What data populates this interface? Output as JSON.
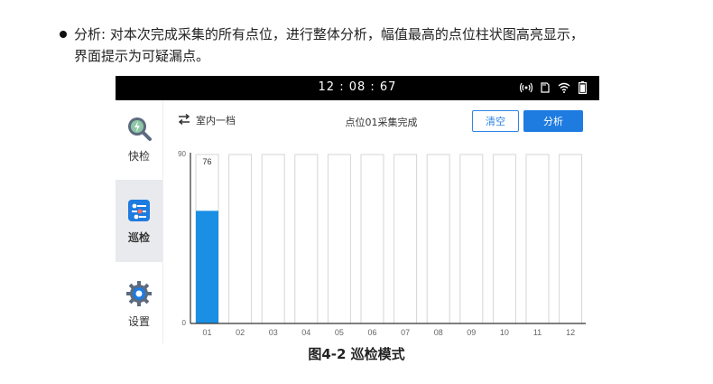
{
  "doc": {
    "bullet_line1": "分析: 对本次完成采集的所有点位，进行整体分析，幅值最高的点位柱状图高亮显示，",
    "bullet_line2": "界面提示为可疑漏点。",
    "caption": "图4-2  巡检模式"
  },
  "status_bar": {
    "time": "12 : 08 : 67"
  },
  "sidebar": {
    "items": [
      {
        "label": "快检",
        "icon": "quick-check-icon",
        "active": false
      },
      {
        "label": "巡检",
        "icon": "patrol-icon",
        "active": true
      },
      {
        "label": "设置",
        "icon": "settings-gear-icon",
        "active": false
      }
    ]
  },
  "toolbar": {
    "mode_label": "室内一档",
    "status_text": "点位01采集完成",
    "clear_label": "清空",
    "analyze_label": "分析"
  },
  "colors": {
    "accent": "#1e7be0",
    "bar": "#1a8fe3",
    "statusbar": "#000000"
  },
  "chart_data": {
    "type": "bar",
    "categories": [
      "01",
      "02",
      "03",
      "04",
      "05",
      "06",
      "07",
      "08",
      "09",
      "10",
      "11",
      "12"
    ],
    "values": [
      60,
      null,
      null,
      null,
      null,
      null,
      null,
      null,
      null,
      null,
      null,
      null
    ],
    "data_labels": [
      "76",
      "",
      "",
      "",
      "",
      "",
      "",
      "",
      "",
      "",
      "",
      ""
    ],
    "ylim": [
      0,
      90
    ],
    "y_ticks": [
      "90",
      "0"
    ],
    "title": "",
    "xlabel": "",
    "ylabel": "",
    "grid": false
  }
}
